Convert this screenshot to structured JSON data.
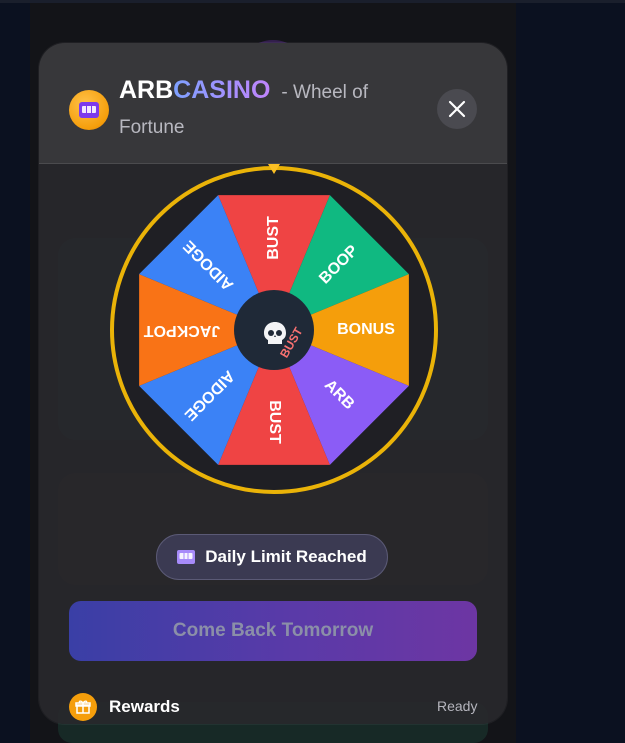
{
  "app": {
    "brand_part1": "ARB",
    "brand_part2": "CASINO",
    "subtitle_part1": "- Wheel of",
    "subtitle_part2": "Fortune",
    "close_icon": "close-icon",
    "logo_icon": "slot-machine-icon"
  },
  "wheel": {
    "segments": [
      {
        "label": "BUST",
        "color": "#ef4444"
      },
      {
        "label": "BOOP",
        "color": "#10b981"
      },
      {
        "label": "BONUS",
        "color": "#f59e0b"
      },
      {
        "label": "ARB",
        "color": "#8b5cf6"
      },
      {
        "label": "BUST",
        "color": "#ef4444"
      },
      {
        "label": "AIDOGE",
        "color": "#3b82f6"
      },
      {
        "label": "JACKPOT",
        "color": "#f97316"
      },
      {
        "label": "AIDOGE",
        "color": "#3b82f6"
      }
    ],
    "center_label": "BUST",
    "center_icon": "skull-icon",
    "rim_color": "#eab308",
    "pointer_color": "#fbbf24"
  },
  "status": {
    "label": "Daily Limit Reached",
    "icon": "slot-machine-icon"
  },
  "cta": {
    "label": "Come Back Tomorrow"
  },
  "rewards": {
    "label": "Rewards",
    "status": "Ready",
    "icon": "gift-icon"
  }
}
